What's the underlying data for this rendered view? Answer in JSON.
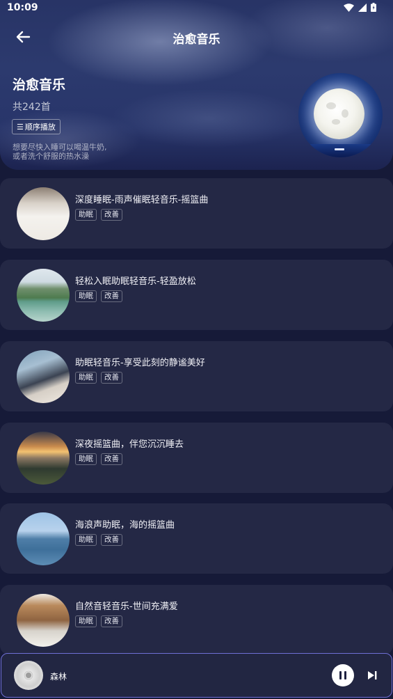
{
  "status": {
    "time": "10:09"
  },
  "nav": {
    "title": "治愈音乐"
  },
  "album": {
    "title": "治愈音乐",
    "count": "共242首",
    "play_order_icon": "☰",
    "play_order_label": "顺序播放",
    "description_line1": "想要尽快入睡可以喝温牛奶,",
    "description_line2": "或者洗个舒服的热水澡"
  },
  "songs": [
    {
      "title": "深度睡眠-雨声催眠轻音乐-摇篮曲",
      "tags": [
        "助眠",
        "改善"
      ]
    },
    {
      "title": "轻松入眠助眠轻音乐-轻盈放松",
      "tags": [
        "助眠",
        "改善"
      ]
    },
    {
      "title": "助眠轻音乐-享受此刻的静谧美好",
      "tags": [
        "助眠",
        "改善"
      ]
    },
    {
      "title": "深夜摇篮曲，伴您沉沉睡去",
      "tags": [
        "助眠",
        "改善"
      ]
    },
    {
      "title": "海浪声助眠，海的摇篮曲",
      "tags": [
        "助眠",
        "改善"
      ]
    },
    {
      "title": "自然音轻音乐-世间充满爱",
      "tags": [
        "助眠",
        "改善"
      ]
    }
  ],
  "player": {
    "now_playing": "森林",
    "state": "playing"
  },
  "colors": {
    "accent_border": "#6f6fd6",
    "card_bg": "#242845",
    "page_bg": "#161a38"
  }
}
